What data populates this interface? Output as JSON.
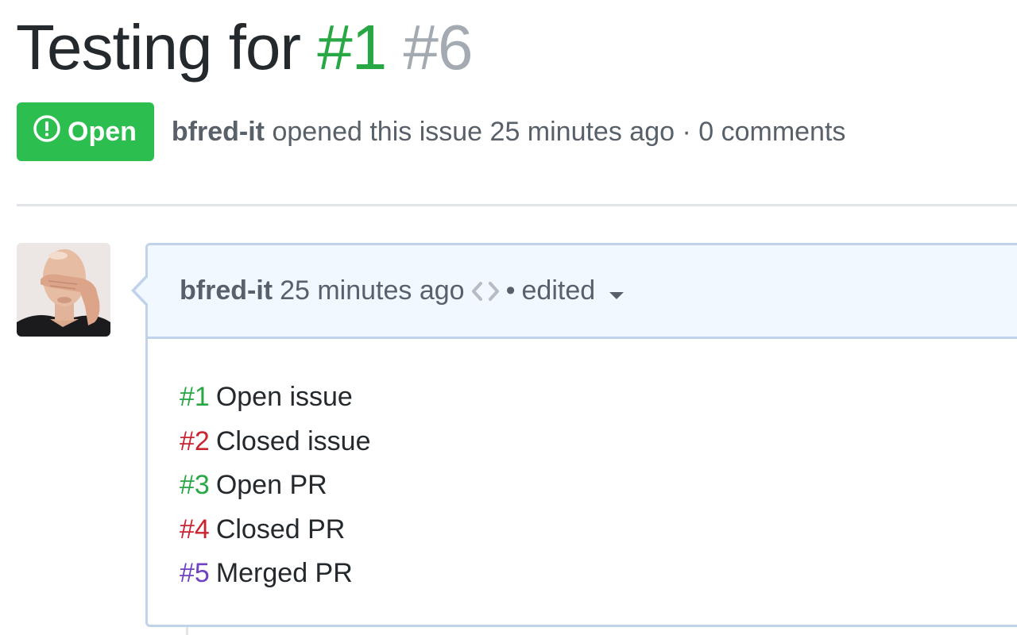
{
  "issue": {
    "title": "Testing for",
    "ref_open": "#1",
    "ref_number": "#6",
    "state_label": "Open",
    "author": "bfred-it",
    "meta_text": "opened this issue 25 minutes ago · 0 comments"
  },
  "comment": {
    "author": "bfred-it",
    "time": "25 minutes ago",
    "dot": "•",
    "edited_label": "edited",
    "references": [
      {
        "number": "#1",
        "label": "Open issue",
        "status": "open"
      },
      {
        "number": "#2",
        "label": "Closed issue",
        "status": "closed"
      },
      {
        "number": "#3",
        "label": "Open PR",
        "status": "open"
      },
      {
        "number": "#4",
        "label": "Closed PR",
        "status": "closed"
      },
      {
        "number": "#5",
        "label": "Merged PR",
        "status": "merged"
      }
    ]
  },
  "icons": {
    "state": "issue-opened-icon",
    "code": "code-icon",
    "edited_dropdown": "triangle-down-icon"
  },
  "colors": {
    "open": "#28a745",
    "open_badge": "#2cbe4e",
    "closed": "#cb2431",
    "merged": "#6f42c1",
    "muted": "#a3aab1",
    "header_bg": "#f1f8ff",
    "border": "#c0d3eb"
  }
}
